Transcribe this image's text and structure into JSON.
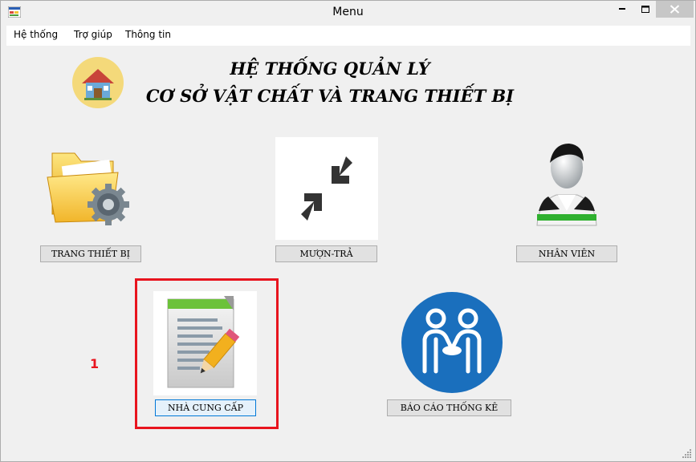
{
  "window": {
    "title": "Menu",
    "controls": {
      "minimize": "minimize",
      "maximize": "maximize",
      "close": "close"
    }
  },
  "menubar": {
    "items": [
      {
        "label": "Hệ thống"
      },
      {
        "label": "Trợ giúp"
      },
      {
        "label": "Thông tin"
      }
    ]
  },
  "header": {
    "line1": "HỆ THỐNG QUẢN LÝ",
    "line2": "CƠ SỞ VẬT CHẤT VÀ TRANG THIẾT BỊ"
  },
  "modules": {
    "equipment": {
      "label": "TRANG THIẾT BỊ",
      "icon": "folder-gear-icon"
    },
    "borrow_return": {
      "label": "MƯỢN-TRẢ",
      "icon": "arrows-inward-icon"
    },
    "staff": {
      "label": "NHÂN VIÊN",
      "icon": "person-avatar-icon"
    },
    "supplier": {
      "label": "NHÀ CUNG CẤP",
      "icon": "document-pencil-icon"
    },
    "report": {
      "label": "BÁO CÁO THỐNG KÊ",
      "icon": "handshake-icon"
    }
  },
  "annotation": {
    "step_number": "1",
    "color": "#e8141e"
  },
  "colors": {
    "background": "#f0f0f0",
    "close_button": "#c7c7c7",
    "focus_border": "#0078d7",
    "report_icon_blue": "#1a6fbd"
  }
}
